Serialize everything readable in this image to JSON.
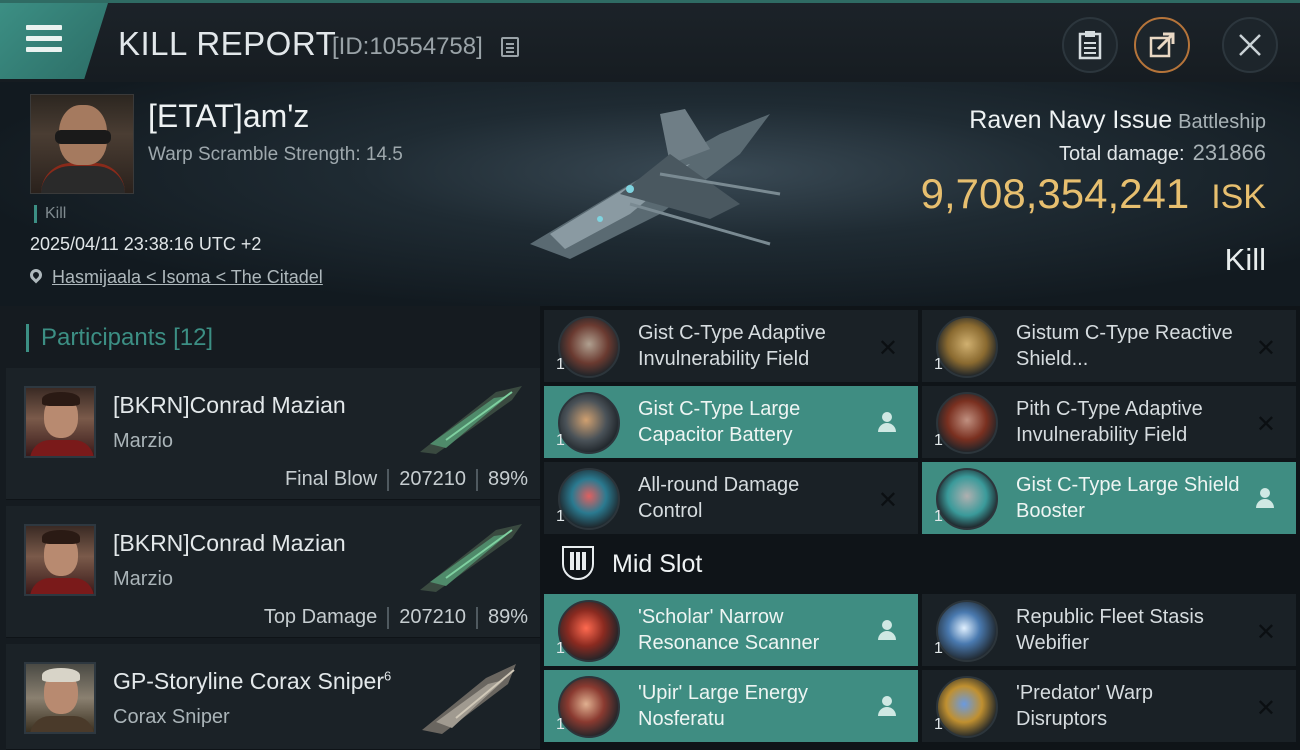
{
  "header": {
    "title": "KILL REPORT",
    "report_id": "[ID:10554758]",
    "icons": [
      "menu-icon",
      "copy-icon",
      "clipboard-icon",
      "share-icon",
      "close-icon"
    ]
  },
  "victim": {
    "name": "[ETAT]am'z",
    "warp_scramble": "Warp Scramble Strength: 14.5",
    "kill_tag": "Kill",
    "timestamp": "2025/04/11 23:38:16 UTC +2",
    "location": "Hasmijaala < Isoma < The Citadel",
    "ship_name": "Raven Navy Issue",
    "ship_class": "Battleship",
    "total_damage_label": "Total damage:",
    "total_damage": "231866",
    "isk_value": "9,708,354,241",
    "isk_unit": "ISK",
    "result": "Kill"
  },
  "participants": {
    "title": "Participants",
    "count": "[12]",
    "rows": [
      {
        "name": "[BKRN]Conrad Mazian",
        "ship": "Marzio",
        "role": "Final Blow",
        "damage": "207210",
        "percent": "89%"
      },
      {
        "name": "[BKRN]Conrad Mazian",
        "ship": "Marzio",
        "role": "Top Damage",
        "damage": "207210",
        "percent": "89%"
      },
      {
        "name": "GP-Storyline Corax Sniper",
        "name_sup": "6",
        "ship": "Corax Sniper"
      }
    ]
  },
  "modules": {
    "low": [
      {
        "name": "Gist C-Type Adaptive Invulnerability Field",
        "qty": "1",
        "status": "destroyed"
      },
      {
        "name": "Gistum C-Type Reactive Shield...",
        "qty": "1",
        "status": "destroyed"
      },
      {
        "name": "Gist C-Type Large Capacitor Battery",
        "qty": "1",
        "status": "dropped"
      },
      {
        "name": "Pith C-Type Adaptive Invulnerability Field",
        "qty": "1",
        "status": "destroyed"
      },
      {
        "name": "All-round Damage Control",
        "qty": "1",
        "status": "destroyed"
      },
      {
        "name": "Gist C-Type Large Shield Booster",
        "qty": "1",
        "status": "dropped"
      }
    ],
    "mid_slot_title": "Mid Slot",
    "mid": [
      {
        "name": "'Scholar' Narrow Resonance Scanner",
        "qty": "1",
        "status": "dropped"
      },
      {
        "name": "Republic Fleet Stasis Webifier",
        "qty": "1",
        "status": "destroyed"
      },
      {
        "name": "'Upir' Large Energy Nosferatu",
        "qty": "1",
        "status": "dropped"
      },
      {
        "name": "'Predator' Warp Disruptors",
        "qty": "1",
        "status": "destroyed"
      }
    ]
  },
  "colors": {
    "accent": "#3f8d82",
    "isk": "#e7bf6f",
    "share_ring": "#b5743a"
  }
}
